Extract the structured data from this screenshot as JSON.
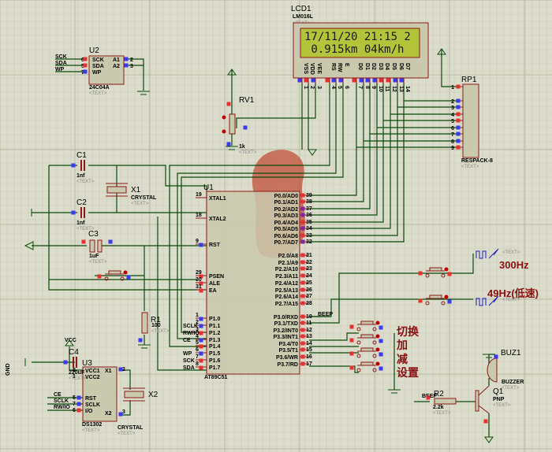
{
  "colors": {
    "background": "#dcdccc",
    "grid": "#c4c4b2",
    "wire": "#0a4a0a",
    "component_border": "#8b1a1a",
    "component_fill": "#c9c9ad",
    "lcd_screen": "#b4c43a",
    "pin_high": "#e83030",
    "pin_low": "#3a3af0",
    "annotation": "#8b1010"
  },
  "text_placeholder": "<TEXT>",
  "lcd": {
    "ref": "LCD1",
    "part": "LM016L",
    "line1": "17/11/20 21:15 2",
    "line2": " 0.915km 04km/h",
    "pins": [
      "VSS",
      "VDD",
      "VEE",
      "RS",
      "RW",
      "E",
      "D0",
      "D1",
      "D2",
      "D3",
      "D4",
      "D5",
      "D6",
      "D7"
    ],
    "pin_numbers": [
      "1",
      "2",
      "3",
      "4",
      "5",
      "6",
      "7",
      "8",
      "9",
      "10",
      "11",
      "12",
      "13",
      "14"
    ]
  },
  "rp1": {
    "ref": "RP1",
    "part": "RESPACK-8",
    "pin_numbers": [
      "1",
      "2",
      "3",
      "4",
      "5",
      "6",
      "7",
      "8",
      "9"
    ]
  },
  "u2": {
    "ref": "U2",
    "part": "24C04A",
    "left_pins": [
      "SCK",
      "SDA",
      "WP"
    ],
    "left_nums": [
      "6",
      "5",
      "7"
    ],
    "right_pins": [
      "A1",
      "A2"
    ],
    "right_nums": [
      "2",
      "3"
    ],
    "net_labels": [
      "SCK",
      "SDA",
      "WP"
    ]
  },
  "rv1": {
    "ref": "RV1",
    "value": "1k"
  },
  "c1": {
    "ref": "C1",
    "value": "1nf"
  },
  "c2": {
    "ref": "C2",
    "value": "1nf"
  },
  "c3": {
    "ref": "C3",
    "value": "1uF"
  },
  "c4": {
    "ref": "C4",
    "value": "220uF"
  },
  "x1": {
    "ref": "X1",
    "value": "CRYSTAL"
  },
  "x2": {
    "ref": "X2",
    "value": "CRYSTAL"
  },
  "r1": {
    "ref": "R1",
    "value": "100"
  },
  "r2": {
    "ref": "R2",
    "value": "2.2k"
  },
  "q1": {
    "ref": "Q1",
    "value": "PNP"
  },
  "buz1": {
    "ref": "BUZ1",
    "value": "BUZZER"
  },
  "u1": {
    "ref": "U1",
    "part": "AT89C51",
    "left": [
      {
        "n": "19",
        "p": "XTAL1"
      },
      {
        "n": "18",
        "p": "XTAL2"
      },
      {
        "n": "9",
        "p": "RST"
      },
      {
        "n": "29",
        "p": "PSEN"
      },
      {
        "n": "30",
        "p": "ALE"
      },
      {
        "n": "31",
        "p": "EA"
      },
      {
        "n": "1",
        "p": "P1.0"
      },
      {
        "n": "2",
        "p": "P1.1"
      },
      {
        "n": "3",
        "p": "P1.2"
      },
      {
        "n": "4",
        "p": "P1.3"
      },
      {
        "n": "5",
        "p": "P1.4"
      },
      {
        "n": "6",
        "p": "P1.5"
      },
      {
        "n": "7",
        "p": "P1.6"
      },
      {
        "n": "8",
        "p": "P1.7"
      }
    ],
    "p1_nets": [
      "",
      "SCLK",
      "RW/IO",
      "CE",
      "",
      "WP",
      "SCK",
      "SDA"
    ],
    "right": [
      {
        "n": "39",
        "p": "P0.0/AD0"
      },
      {
        "n": "38",
        "p": "P0.1/AD1"
      },
      {
        "n": "37",
        "p": "P0.2/AD2"
      },
      {
        "n": "36",
        "p": "P0.3/AD3"
      },
      {
        "n": "35",
        "p": "P0.4/AD4"
      },
      {
        "n": "34",
        "p": "P0.5/AD5"
      },
      {
        "n": "33",
        "p": "P0.6/AD6"
      },
      {
        "n": "32",
        "p": "P0.7/AD7"
      },
      {
        "n": "21",
        "p": "P2.0/A8"
      },
      {
        "n": "22",
        "p": "P2.1/A9"
      },
      {
        "n": "23",
        "p": "P2.2/A10"
      },
      {
        "n": "24",
        "p": "P2.3/A11"
      },
      {
        "n": "25",
        "p": "P2.4/A12"
      },
      {
        "n": "26",
        "p": "P2.5/A13"
      },
      {
        "n": "27",
        "p": "P2.6/A14"
      },
      {
        "n": "28",
        "p": "P2.7/A15"
      },
      {
        "n": "10",
        "p": "P3.0/RXD"
      },
      {
        "n": "11",
        "p": "P3.1/TXD"
      },
      {
        "n": "12",
        "p": "P3.2/INT0"
      },
      {
        "n": "13",
        "p": "P3.3/INT1"
      },
      {
        "n": "14",
        "p": "P3.4/T0"
      },
      {
        "n": "15",
        "p": "P3.5/T1"
      },
      {
        "n": "16",
        "p": "P3.6/WR"
      },
      {
        "n": "17",
        "p": "P3.7/RD"
      }
    ],
    "beep_net": "BEEP"
  },
  "u3": {
    "ref": "U3",
    "part": "DS1302",
    "left_pins": [
      "VCC1",
      "VCC2",
      "RST",
      "SCLK",
      "I/O"
    ],
    "left_nums": [
      "8",
      "1",
      "5",
      "7",
      "6"
    ],
    "right_pins": [
      "X1",
      "X2"
    ],
    "right_nums": [
      "2",
      "3"
    ],
    "nets": [
      "CE",
      "SCLK",
      "RW/IO"
    ],
    "vcc": "VCC",
    "gnd": "GND"
  },
  "r2_net": "BEEP",
  "generators": {
    "g1_label": "300Hz",
    "g2_label": "49Hz(低速)"
  },
  "buttons": {
    "b1": "切换",
    "b2": "加",
    "b3": "减",
    "b4": "设置"
  }
}
